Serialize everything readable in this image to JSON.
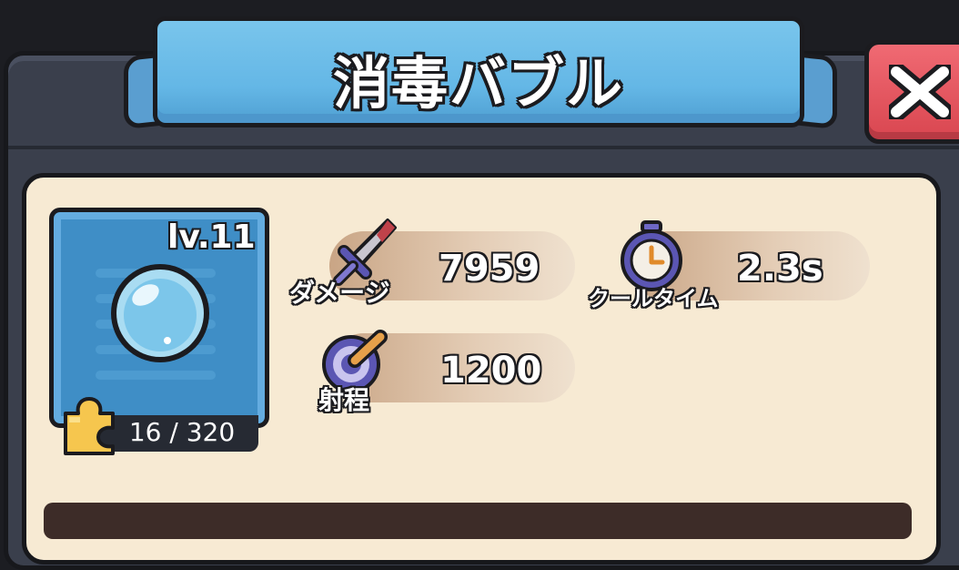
{
  "dialog": {
    "title": "消毒バブル"
  },
  "close_button": {
    "icon": "close-icon"
  },
  "item": {
    "level": "lv.11",
    "icon": "bubble-icon",
    "shards": "16 / 320",
    "shard_icon": "puzzle-piece-icon"
  },
  "stats": {
    "damage": {
      "label": "ダメージ",
      "value": "7959",
      "icon": "dagger-icon"
    },
    "cooldown": {
      "label": "クールタイム",
      "value": "2.3s",
      "icon": "stopwatch-icon"
    },
    "range": {
      "label": "射程",
      "value": "1200",
      "icon": "target-icon"
    }
  },
  "colors": {
    "banner": "#64b7e6",
    "close": "#e1525b",
    "panel": "#f7ead3",
    "frame": "#3a3f4c",
    "card": "#3f8ec6"
  }
}
